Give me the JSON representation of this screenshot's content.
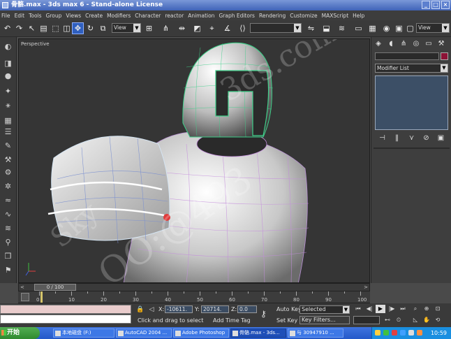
{
  "window": {
    "title": "骨骼.max - 3ds max 6 - Stand-alone License"
  },
  "menu": [
    "File",
    "Edit",
    "Tools",
    "Group",
    "Views",
    "Create",
    "Modifiers",
    "Character",
    "reactor",
    "Animation",
    "Graph Editors",
    "Rendering",
    "Customize",
    "MAXScript",
    "Help"
  ],
  "toolbar": {
    "refcoord_left": "View",
    "refcoord_right": "View",
    "named_selection": ""
  },
  "viewport": {
    "label": "Perspective",
    "watermark_1": "3ds.com",
    "watermark_2": "OO:@493",
    "watermark_3": "Sky"
  },
  "command_panel": {
    "modifier_list": "Modifier List",
    "object_color": "#8c1236"
  },
  "timeline": {
    "counter": "0 / 100",
    "left_arrow": "<",
    "right_arrow": ">",
    "ticks": [
      "0",
      "10",
      "20",
      "30",
      "40",
      "50",
      "60",
      "70",
      "80",
      "90",
      "100"
    ]
  },
  "status": {
    "x_label": "X:",
    "x_value": "-10611.",
    "y_label": "Y:",
    "y_value": "20714.",
    "z_label": "Z:",
    "z_value": "0.0",
    "prompt": "Click and drag to select",
    "add_time_tag": "Add Time Tag",
    "auto_key": "Auto Key",
    "set_key": "Set Key",
    "selected": "Selected",
    "key_filters": "Key Filters..."
  },
  "taskbar": {
    "start": "开始",
    "tasks": [
      "本地磁盘 (F:)",
      "AutoCAD 2004 ...",
      "Adobe Photoshop",
      "骨骼.max - 3ds...",
      "与 30947910 ..."
    ],
    "clock": "10:59"
  }
}
